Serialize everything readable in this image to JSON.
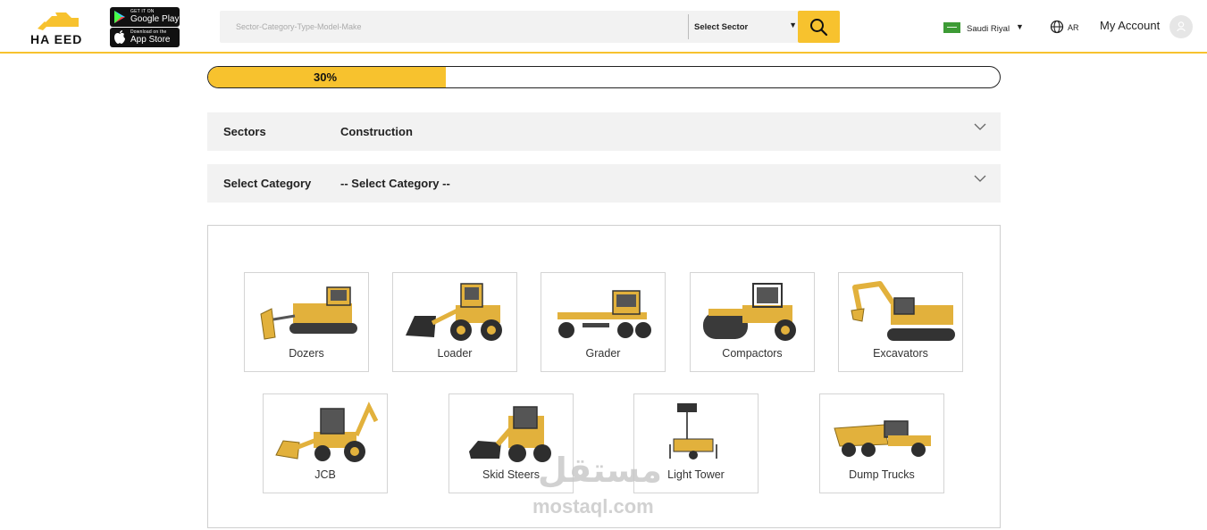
{
  "header": {
    "logo_text": "HA  EED",
    "google_play": {
      "small": "GET IT ON",
      "big": "Google Play"
    },
    "app_store": {
      "small": "Download on the",
      "big": "App Store"
    },
    "search_placeholder": "Sector-Category-Type-Model-Make",
    "sector_select": "Select Sector",
    "currency": "Saudi Riyal",
    "language": "AR",
    "account": "My Account"
  },
  "progress": {
    "label": "30%",
    "value": 0.3
  },
  "filters": [
    {
      "key": "Sectors",
      "value": "Construction"
    },
    {
      "key": "Select Category",
      "value": "-- Select Category --"
    }
  ],
  "categories": [
    {
      "label": "Dozers",
      "icon": "dozer-icon"
    },
    {
      "label": "Loader",
      "icon": "loader-icon"
    },
    {
      "label": "Grader",
      "icon": "grader-icon"
    },
    {
      "label": "Compactors",
      "icon": "compactor-icon"
    },
    {
      "label": "Excavators",
      "icon": "excavator-icon"
    },
    {
      "label": "JCB",
      "icon": "backhoe-icon"
    },
    {
      "label": "Skid Steers",
      "icon": "skid-steer-icon"
    },
    {
      "label": "Light Tower",
      "icon": "light-tower-icon"
    },
    {
      "label": "Dump Trucks",
      "icon": "dump-truck-icon"
    }
  ],
  "watermark": {
    "arabic": "مستقل",
    "latin": "mostaql.com"
  },
  "colors": {
    "accent": "#f7c22e",
    "machine": "#e2b13c"
  }
}
